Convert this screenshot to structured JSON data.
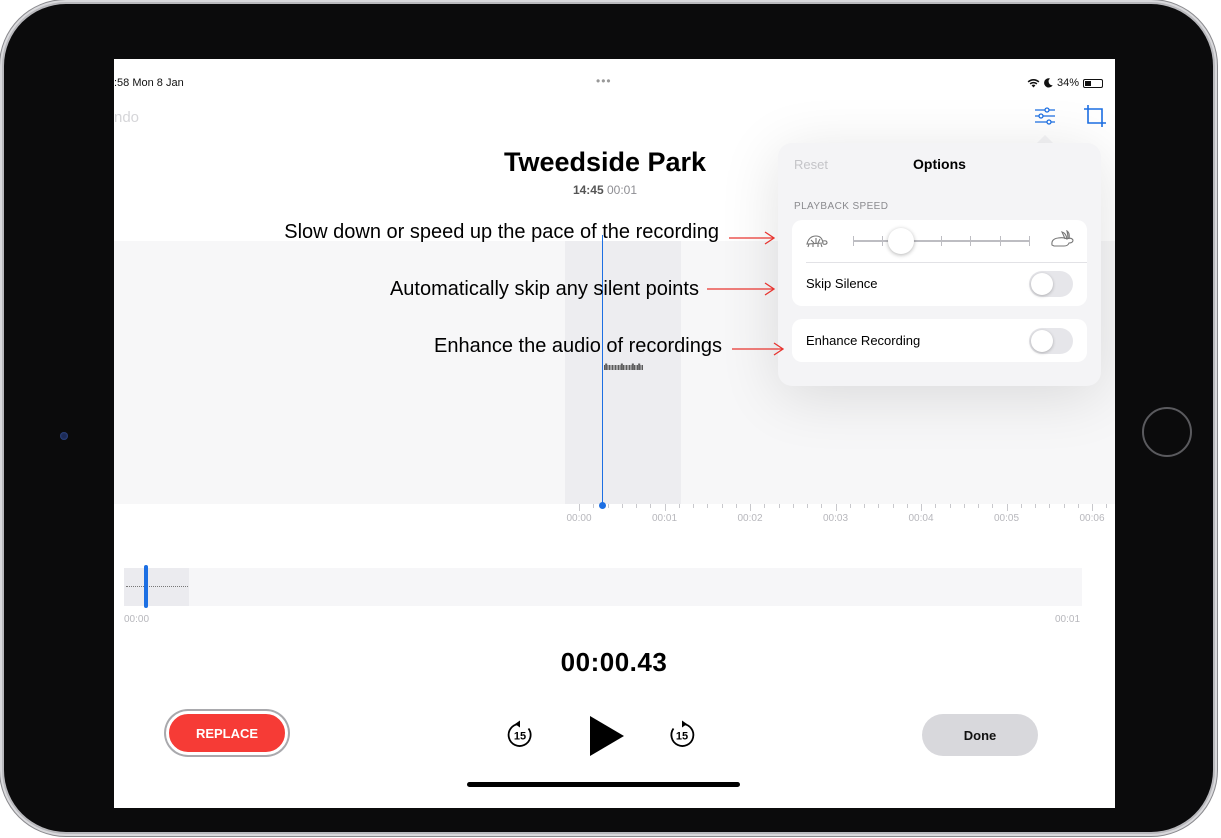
{
  "status_bar": {
    "time": ":58  Mon 8 Jan",
    "center_dots": "•••",
    "battery": "34%"
  },
  "toolbar": {
    "undo_label": "ndo"
  },
  "recording": {
    "title": "Tweedside Park",
    "time_of_day": "14:45",
    "duration": "00:01"
  },
  "waveform": {
    "glyphs": "ıllıııııııııllııııııllıııllıı"
  },
  "ruler": [
    "00:00",
    "00:01",
    "00:02",
    "00:03",
    "00:04",
    "00:05",
    "00:06"
  ],
  "scrubber": {
    "start": "00:00",
    "end": "00:01"
  },
  "playback": {
    "elapsed": "00:00.43",
    "skip_back_label": "15",
    "skip_forward_label": "15"
  },
  "buttons": {
    "replace": "REPLACE",
    "done": "Done"
  },
  "options_panel": {
    "reset": "Reset",
    "title": "Options",
    "section_playback_speed": "PLAYBACK SPEED",
    "playback_speed_level": 0.27,
    "skip_silence_label": "Skip Silence",
    "skip_silence_on": false,
    "enhance_label": "Enhance Recording",
    "enhance_on": false
  },
  "annotations": {
    "speed": "Slow down or speed up the pace of the recording",
    "skip": "Automatically skip any silent points",
    "enhance": "Enhance the audio of recordings"
  },
  "colors": {
    "accent_blue": "#1c6fe3",
    "replace_red": "#f63b36",
    "annotation_arrow": "#e8342f"
  }
}
